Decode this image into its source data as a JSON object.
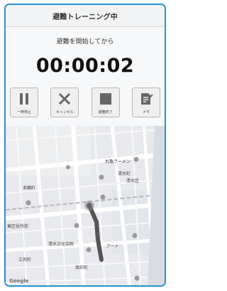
{
  "app": {
    "title": "避難トレーニング中"
  },
  "status": {
    "subtitle": "避難を開始してから",
    "elapsed": "00:00:02"
  },
  "controls": [
    {
      "label": "一時停止",
      "icon": "pause-icon"
    },
    {
      "label": "キャンセル",
      "icon": "close-icon"
    },
    {
      "label": "避難終了",
      "icon": "stop-icon"
    },
    {
      "label": "メモ",
      "icon": "memo-icon"
    }
  ],
  "map": {
    "labels": {
      "a": "本願町",
      "b": "丸亀ラーメン",
      "c": "清水町",
      "d": "東区役所前",
      "e": "清水区",
      "f": "清水文化会館",
      "g": "江尻町",
      "h": "真砂町",
      "i": "アート"
    },
    "attribution": "Google"
  },
  "colors": {
    "accent": "#2b8fd1",
    "route": "#555555"
  }
}
